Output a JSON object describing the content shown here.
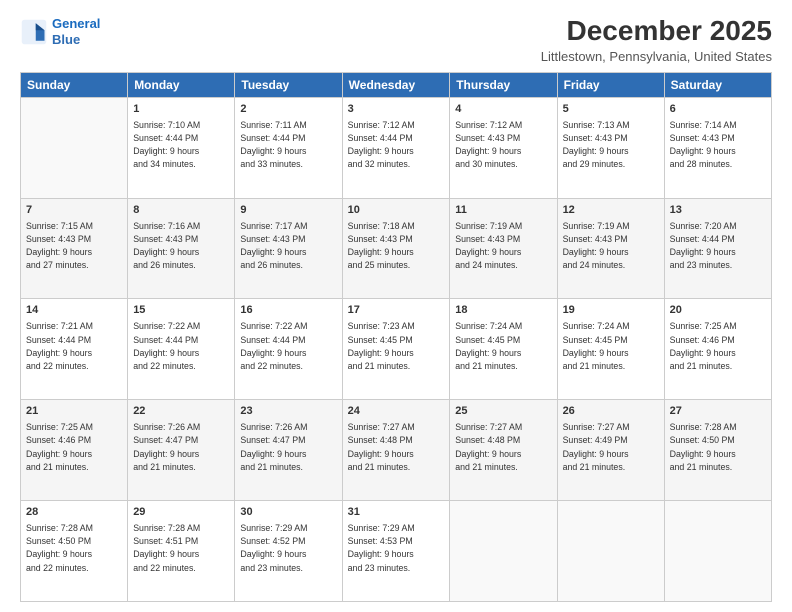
{
  "logo": {
    "line1": "General",
    "line2": "Blue"
  },
  "title": "December 2025",
  "subtitle": "Littlestown, Pennsylvania, United States",
  "days_header": [
    "Sunday",
    "Monday",
    "Tuesday",
    "Wednesday",
    "Thursday",
    "Friday",
    "Saturday"
  ],
  "weeks": [
    [
      {
        "num": "",
        "info": ""
      },
      {
        "num": "1",
        "info": "Sunrise: 7:10 AM\nSunset: 4:44 PM\nDaylight: 9 hours\nand 34 minutes."
      },
      {
        "num": "2",
        "info": "Sunrise: 7:11 AM\nSunset: 4:44 PM\nDaylight: 9 hours\nand 33 minutes."
      },
      {
        "num": "3",
        "info": "Sunrise: 7:12 AM\nSunset: 4:44 PM\nDaylight: 9 hours\nand 32 minutes."
      },
      {
        "num": "4",
        "info": "Sunrise: 7:12 AM\nSunset: 4:43 PM\nDaylight: 9 hours\nand 30 minutes."
      },
      {
        "num": "5",
        "info": "Sunrise: 7:13 AM\nSunset: 4:43 PM\nDaylight: 9 hours\nand 29 minutes."
      },
      {
        "num": "6",
        "info": "Sunrise: 7:14 AM\nSunset: 4:43 PM\nDaylight: 9 hours\nand 28 minutes."
      }
    ],
    [
      {
        "num": "7",
        "info": "Sunrise: 7:15 AM\nSunset: 4:43 PM\nDaylight: 9 hours\nand 27 minutes."
      },
      {
        "num": "8",
        "info": "Sunrise: 7:16 AM\nSunset: 4:43 PM\nDaylight: 9 hours\nand 26 minutes."
      },
      {
        "num": "9",
        "info": "Sunrise: 7:17 AM\nSunset: 4:43 PM\nDaylight: 9 hours\nand 26 minutes."
      },
      {
        "num": "10",
        "info": "Sunrise: 7:18 AM\nSunset: 4:43 PM\nDaylight: 9 hours\nand 25 minutes."
      },
      {
        "num": "11",
        "info": "Sunrise: 7:19 AM\nSunset: 4:43 PM\nDaylight: 9 hours\nand 24 minutes."
      },
      {
        "num": "12",
        "info": "Sunrise: 7:19 AM\nSunset: 4:43 PM\nDaylight: 9 hours\nand 24 minutes."
      },
      {
        "num": "13",
        "info": "Sunrise: 7:20 AM\nSunset: 4:44 PM\nDaylight: 9 hours\nand 23 minutes."
      }
    ],
    [
      {
        "num": "14",
        "info": "Sunrise: 7:21 AM\nSunset: 4:44 PM\nDaylight: 9 hours\nand 22 minutes."
      },
      {
        "num": "15",
        "info": "Sunrise: 7:22 AM\nSunset: 4:44 PM\nDaylight: 9 hours\nand 22 minutes."
      },
      {
        "num": "16",
        "info": "Sunrise: 7:22 AM\nSunset: 4:44 PM\nDaylight: 9 hours\nand 22 minutes."
      },
      {
        "num": "17",
        "info": "Sunrise: 7:23 AM\nSunset: 4:45 PM\nDaylight: 9 hours\nand 21 minutes."
      },
      {
        "num": "18",
        "info": "Sunrise: 7:24 AM\nSunset: 4:45 PM\nDaylight: 9 hours\nand 21 minutes."
      },
      {
        "num": "19",
        "info": "Sunrise: 7:24 AM\nSunset: 4:45 PM\nDaylight: 9 hours\nand 21 minutes."
      },
      {
        "num": "20",
        "info": "Sunrise: 7:25 AM\nSunset: 4:46 PM\nDaylight: 9 hours\nand 21 minutes."
      }
    ],
    [
      {
        "num": "21",
        "info": "Sunrise: 7:25 AM\nSunset: 4:46 PM\nDaylight: 9 hours\nand 21 minutes."
      },
      {
        "num": "22",
        "info": "Sunrise: 7:26 AM\nSunset: 4:47 PM\nDaylight: 9 hours\nand 21 minutes."
      },
      {
        "num": "23",
        "info": "Sunrise: 7:26 AM\nSunset: 4:47 PM\nDaylight: 9 hours\nand 21 minutes."
      },
      {
        "num": "24",
        "info": "Sunrise: 7:27 AM\nSunset: 4:48 PM\nDaylight: 9 hours\nand 21 minutes."
      },
      {
        "num": "25",
        "info": "Sunrise: 7:27 AM\nSunset: 4:48 PM\nDaylight: 9 hours\nand 21 minutes."
      },
      {
        "num": "26",
        "info": "Sunrise: 7:27 AM\nSunset: 4:49 PM\nDaylight: 9 hours\nand 21 minutes."
      },
      {
        "num": "27",
        "info": "Sunrise: 7:28 AM\nSunset: 4:50 PM\nDaylight: 9 hours\nand 21 minutes."
      }
    ],
    [
      {
        "num": "28",
        "info": "Sunrise: 7:28 AM\nSunset: 4:50 PM\nDaylight: 9 hours\nand 22 minutes."
      },
      {
        "num": "29",
        "info": "Sunrise: 7:28 AM\nSunset: 4:51 PM\nDaylight: 9 hours\nand 22 minutes."
      },
      {
        "num": "30",
        "info": "Sunrise: 7:29 AM\nSunset: 4:52 PM\nDaylight: 9 hours\nand 23 minutes."
      },
      {
        "num": "31",
        "info": "Sunrise: 7:29 AM\nSunset: 4:53 PM\nDaylight: 9 hours\nand 23 minutes."
      },
      {
        "num": "",
        "info": ""
      },
      {
        "num": "",
        "info": ""
      },
      {
        "num": "",
        "info": ""
      }
    ]
  ]
}
